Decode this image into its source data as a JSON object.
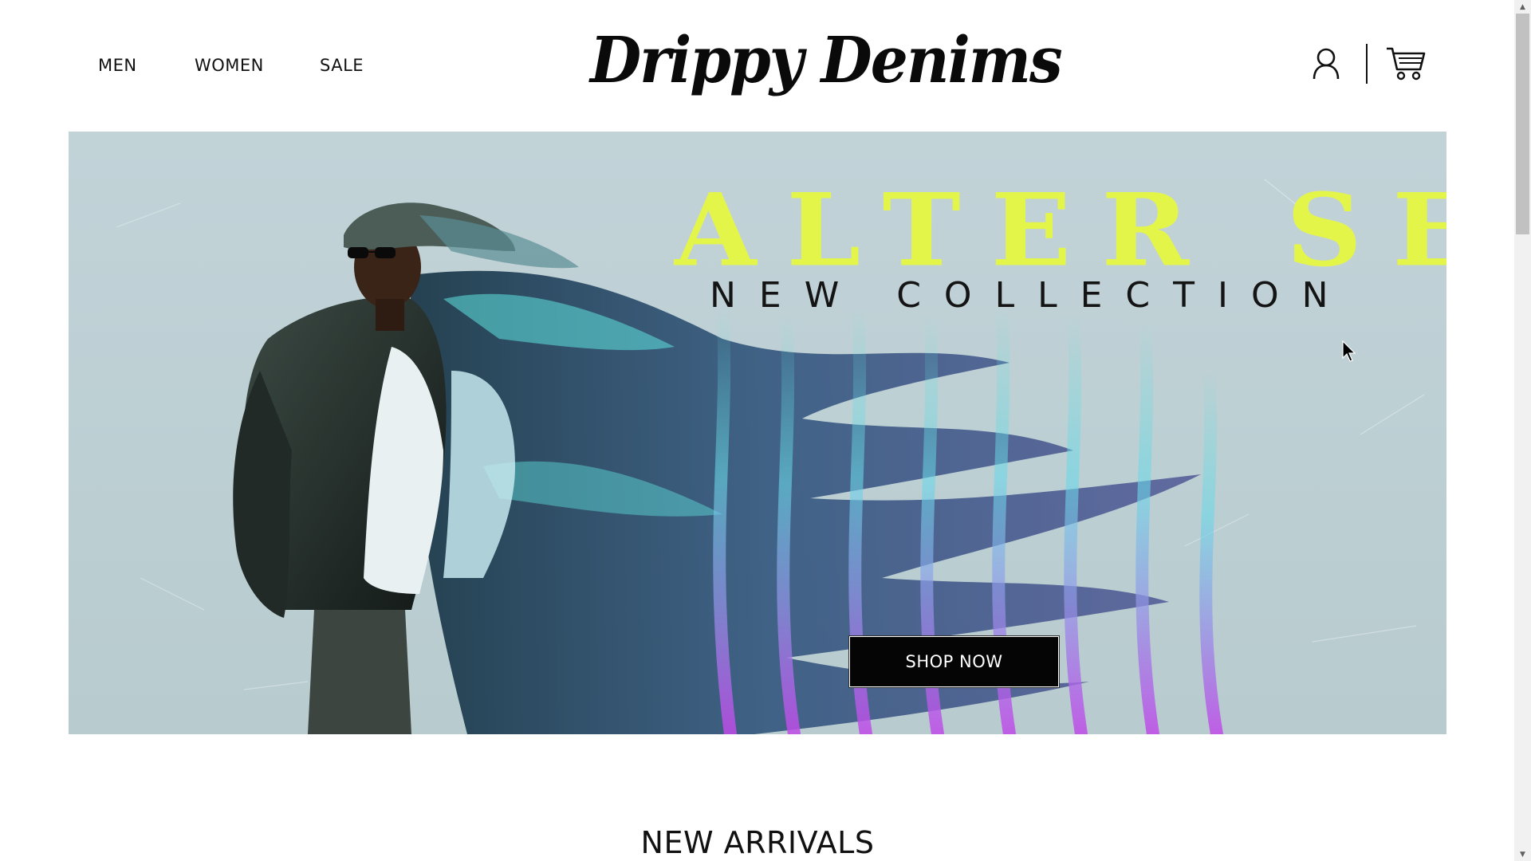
{
  "header": {
    "nav": {
      "men": "MEN",
      "women": "WOMEN",
      "sale": "SALE"
    },
    "logo_text": "Drippy Denims",
    "icons": {
      "account": "user-icon",
      "cart": "cart-icon"
    }
  },
  "hero": {
    "title": "ALTER SELF",
    "subtitle": "NEW COLLECTION",
    "cta_label": "SHOP NOW",
    "colors": {
      "title": "#e4f54a",
      "background": "#c2d3d8",
      "button": "#050505",
      "streak_teal": "#5fe3e0",
      "streak_purple": "#b04be8"
    }
  },
  "section": {
    "title": "NEW ARRIVALS"
  },
  "scrollbar": {
    "up_arrow": "▲",
    "down_arrow": "▼"
  }
}
